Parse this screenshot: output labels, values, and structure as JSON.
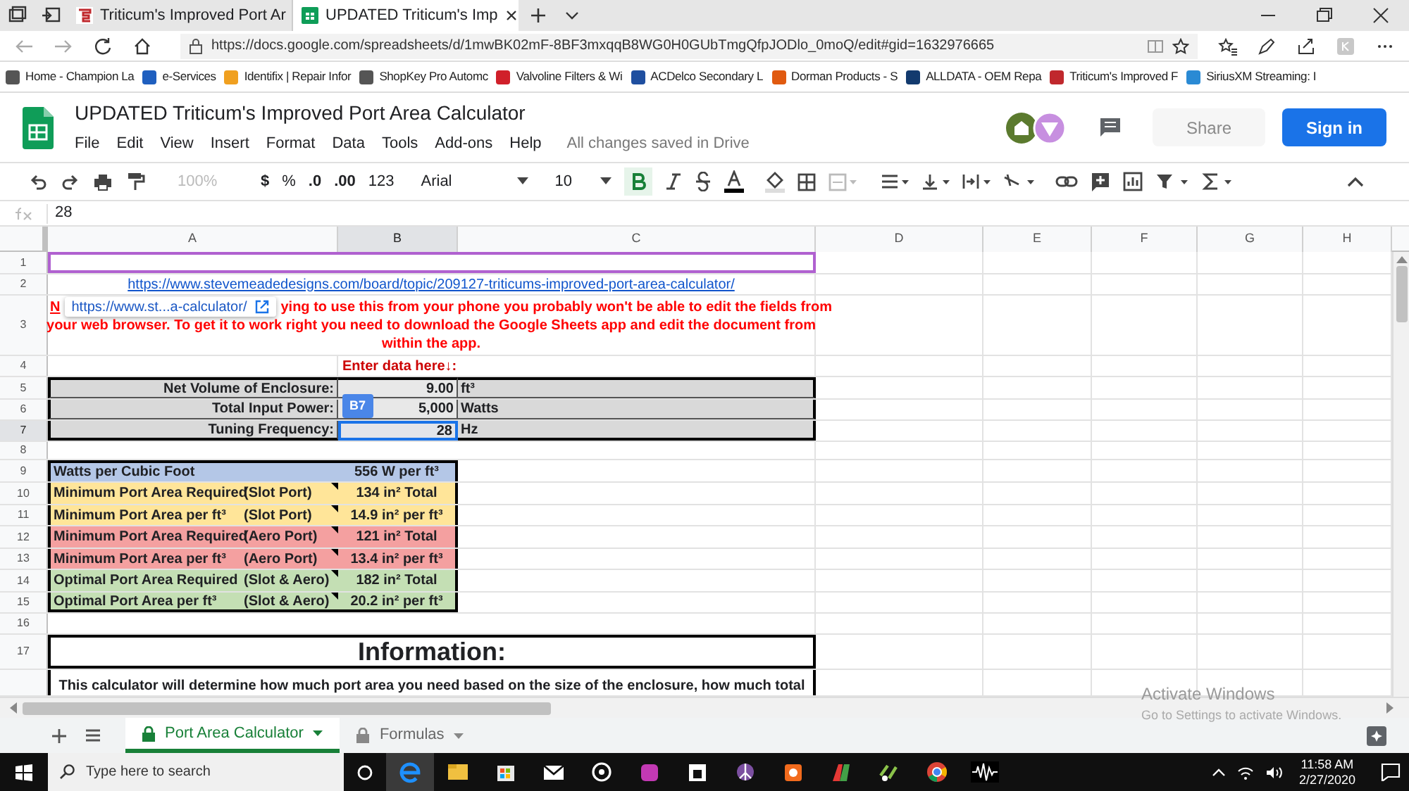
{
  "browser": {
    "tabs": [
      {
        "title": "Triticum's Improved Port Ar",
        "selected": false
      },
      {
        "title": "UPDATED Triticum's Imp",
        "selected": true
      }
    ],
    "url": "https://docs.google.com/spreadsheets/d/1mwBK02mF-8BF3mxqqB8WG0H0GUbTmgQfpJODlo_0moQ/edit#gid=1632976665",
    "bookmarks": [
      {
        "label": "Home - Champion La",
        "color": "#555555"
      },
      {
        "label": "e-Services",
        "color": "#1f5fbf"
      },
      {
        "label": "Identifix | Repair Infor",
        "color": "#f0a020"
      },
      {
        "label": "ShopKey Pro Automc",
        "color": "#555555"
      },
      {
        "label": "Valvoline Filters & Wi",
        "color": "#d0202a"
      },
      {
        "label": "ACDelco Secondary L",
        "color": "#1f4fa0"
      },
      {
        "label": "Dorman Products - S",
        "color": "#e05a10"
      },
      {
        "label": "ALLDATA - OEM Repa",
        "color": "#123a6e"
      },
      {
        "label": "Triticum's Improved F",
        "color": "#c0282d"
      },
      {
        "label": "SiriusXM Streaming: I",
        "color": "#2a8ad4"
      }
    ]
  },
  "document": {
    "title": "UPDATED Triticum's Improved Port Area Calculator",
    "menus": [
      "File",
      "Edit",
      "View",
      "Insert",
      "Format",
      "Data",
      "Tools",
      "Add-ons",
      "Help"
    ],
    "save_status": "All changes saved in Drive",
    "share": {
      "label": "Share",
      "disabled": true
    },
    "sign_in": "Sign in"
  },
  "toolbar": {
    "zoom": "100%",
    "currency": "$",
    "percent": "%",
    "decrease_decimals": ".0",
    "increase_decimals": ".00",
    "more_formats": "123",
    "font": "Arial",
    "font_size": "10",
    "bold": true
  },
  "formula_bar": {
    "value": "28"
  },
  "columns": [
    {
      "label": "A",
      "selected": false
    },
    {
      "label": "B",
      "selected": true
    },
    {
      "label": "C",
      "selected": false
    },
    {
      "label": "D",
      "selected": false
    },
    {
      "label": "E",
      "selected": false
    },
    {
      "label": "F",
      "selected": false
    },
    {
      "label": "G",
      "selected": false
    },
    {
      "label": "H",
      "selected": false
    }
  ],
  "selected_cell": "B7",
  "link_tooltip": "https://www.st...a-calculator/",
  "rows": [
    {
      "number": "1",
      "selected": false,
      "kind": "frame"
    },
    {
      "number": "2",
      "selected": false,
      "kind": "link",
      "text": "https://www.stevemeadedesigns.com/board/topic/209127-triticums-improved-port-area-calculator/"
    },
    {
      "number": "3",
      "selected": false,
      "kind": "warning",
      "segments": [
        "N",
        "ying to use this from your phone you probably won't be able to edit the fields from"
      ],
      "lines": [
        "your web browser.  To get it to work right you need to download the Google Sheets app and edit the document from",
        "within the app."
      ]
    },
    {
      "number": "4",
      "selected": false,
      "kind": "prompt",
      "text": "Enter data here↓:"
    },
    {
      "number": "5",
      "selected": false,
      "kind": "input",
      "label": "Net Volume of Enclosure:",
      "value": "9.00",
      "unit": "ft³"
    },
    {
      "number": "6",
      "selected": false,
      "kind": "input",
      "label": "Total Input Power:",
      "value": "5,000",
      "unit": "Watts"
    },
    {
      "number": "7",
      "selected": true,
      "kind": "input",
      "label": "Tuning Frequency:",
      "value": "28",
      "unit": "Hz"
    },
    {
      "number": "8",
      "selected": false,
      "kind": "blank"
    },
    {
      "number": "9",
      "selected": false,
      "kind": "result",
      "label": "Watts per Cubic Foot",
      "value": "556 W per ft³",
      "color": "#b4c7e7",
      "note": false
    },
    {
      "number": "10",
      "selected": false,
      "kind": "result",
      "label": "Minimum Port Area Required",
      "qualifier": "(Slot Port)",
      "value": "134 in² Total",
      "color": "#ffe599",
      "note": true
    },
    {
      "number": "11",
      "selected": false,
      "kind": "result",
      "label": "Minimum Port Area per ft³",
      "qualifier": "(Slot Port)",
      "value": "14.9 in² per ft³",
      "color": "#ffe599",
      "note": true
    },
    {
      "number": "12",
      "selected": false,
      "kind": "result",
      "label": "Minimum Port Area Required",
      "qualifier": "(Aero Port)",
      "value": "121 in² Total",
      "color": "#f4a0a0",
      "note": true
    },
    {
      "number": "13",
      "selected": false,
      "kind": "result",
      "label": "Minimum Port Area per ft³",
      "qualifier": "(Aero Port)",
      "value": "13.4 in² per ft³",
      "color": "#f4a0a0",
      "note": true
    },
    {
      "number": "14",
      "selected": false,
      "kind": "result",
      "label": "Optimal Port Area Required",
      "qualifier": "(Slot & Aero)",
      "value": "182 in² Total",
      "color": "#c4dfb4",
      "note": true
    },
    {
      "number": "15",
      "selected": false,
      "kind": "result",
      "label": "Optimal Port Area per ft³",
      "qualifier": "(Slot & Aero)",
      "value": "20.2 in² per ft³",
      "color": "#c4dfb4",
      "note": true
    },
    {
      "number": "16",
      "selected": false,
      "kind": "blank"
    },
    {
      "number": "17",
      "selected": false,
      "kind": "heading",
      "text": "Information:"
    },
    {
      "kind": "paragraph",
      "text": "This calculator will determine how much port area you need based on the size of the enclosure, how much total"
    }
  ],
  "sheet_tabs": [
    {
      "label": "Port Area Calculator",
      "selected": true
    },
    {
      "label": "Formulas",
      "selected": false
    }
  ],
  "activation": {
    "title": "Activate Windows",
    "subtitle": "Go to Settings to activate Windows."
  },
  "taskbar": {
    "search_placeholder": "Type here to search",
    "time": "11:58 AM",
    "date": "2/27/2020"
  }
}
